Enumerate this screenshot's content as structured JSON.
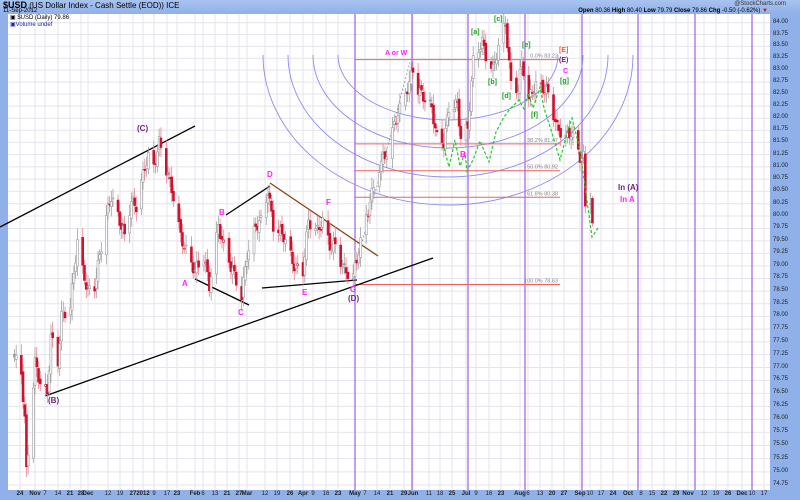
{
  "header": {
    "symbol": "$USD",
    "name": "(US Dollar Index - Cash Settle (EOD)) ICE",
    "date": "11-Sep-2012",
    "brand": "@StockCharts.com",
    "open_label": "Open",
    "open": "80.36",
    "high_label": "High",
    "high": "80.40",
    "low_label": "Low",
    "low": "79.79",
    "close_label": "Close",
    "close": "79.86",
    "chg_label": "Chg",
    "chg": "-0.50 (-0.62%)",
    "chg_icon": "triangle-down-icon"
  },
  "legend": {
    "line1": "$USD (Daily) 79.86",
    "line2": "Volume undef"
  },
  "colors": {
    "up": "#9a9a9a",
    "down": "#d0102c",
    "fib": "#f06060",
    "cycle": "#a060e0",
    "arc": "#8c8cf0",
    "projection": "#22cc22",
    "grid": "#e4e4ee",
    "frame": "#8fb0e8"
  },
  "chart_data": {
    "type": "candlestick",
    "title": "$USD (US Dollar Index - Cash Settle (EOD)) ICE",
    "y_scale": "log",
    "ylim": [
      74.6,
      84.2
    ],
    "grid": true,
    "last_bar": {
      "date": "2012-09-11",
      "open": 80.36,
      "high": 80.4,
      "low": 79.79,
      "close": 79.86
    },
    "approx_closes": [
      [
        "2011-10-20",
        77.2
      ],
      [
        "2011-10-24",
        76.9
      ],
      [
        "2011-10-26",
        76.0
      ],
      [
        "2011-10-27",
        75.0
      ],
      [
        "2011-10-28",
        75.4
      ],
      [
        "2011-11-01",
        77.1
      ],
      [
        "2011-11-04",
        76.7
      ],
      [
        "2011-11-08",
        76.5
      ],
      [
        "2011-11-10",
        77.6
      ],
      [
        "2011-11-14",
        77.1
      ],
      [
        "2011-11-16",
        78.0
      ],
      [
        "2011-11-21",
        78.2
      ],
      [
        "2011-11-25",
        79.5
      ],
      [
        "2011-11-28",
        78.9
      ],
      [
        "2011-12-01",
        78.5
      ],
      [
        "2011-12-05",
        78.6
      ],
      [
        "2011-12-08",
        79.2
      ],
      [
        "2011-12-12",
        80.0
      ],
      [
        "2011-12-15",
        80.4
      ],
      [
        "2011-12-19",
        80.0
      ],
      [
        "2011-12-23",
        79.6
      ],
      [
        "2011-12-27",
        80.3
      ],
      [
        "2011-12-30",
        80.2
      ],
      [
        "2012-01-04",
        81.0
      ],
      [
        "2012-01-06",
        81.2
      ],
      [
        "2012-01-09",
        81.0
      ],
      [
        "2012-01-12",
        81.5
      ],
      [
        "2012-01-13",
        81.4
      ],
      [
        "2012-01-17",
        80.8
      ],
      [
        "2012-01-20",
        80.4
      ],
      [
        "2012-01-24",
        79.6
      ],
      [
        "2012-01-27",
        79.3
      ],
      [
        "2012-02-01",
        78.9
      ],
      [
        "2012-02-06",
        79.2
      ],
      [
        "2012-02-09",
        78.6
      ],
      [
        "2012-02-14",
        79.8
      ],
      [
        "2012-02-17",
        79.4
      ],
      [
        "2012-02-22",
        78.9
      ],
      [
        "2012-02-27",
        78.4
      ],
      [
        "2012-03-01",
        79.2
      ],
      [
        "2012-03-06",
        79.8
      ],
      [
        "2012-03-09",
        79.9
      ],
      [
        "2012-03-13",
        80.5
      ],
      [
        "2012-03-16",
        79.8
      ],
      [
        "2012-03-22",
        79.6
      ],
      [
        "2012-03-28",
        79.0
      ],
      [
        "2012-04-02",
        78.9
      ],
      [
        "2012-04-05",
        79.9
      ],
      [
        "2012-04-10",
        79.7
      ],
      [
        "2012-04-13",
        79.9
      ],
      [
        "2012-04-17",
        79.4
      ],
      [
        "2012-04-20",
        79.4
      ],
      [
        "2012-04-25",
        78.9
      ],
      [
        "2012-04-30",
        78.8
      ],
      [
        "2012-05-03",
        79.3
      ],
      [
        "2012-05-09",
        80.3
      ],
      [
        "2012-05-14",
        81.0
      ],
      [
        "2012-05-18",
        81.3
      ],
      [
        "2012-05-23",
        82.0
      ],
      [
        "2012-05-28",
        82.5
      ],
      [
        "2012-06-01",
        83.0
      ],
      [
        "2012-06-04",
        82.6
      ],
      [
        "2012-06-08",
        82.4
      ],
      [
        "2012-06-12",
        82.2
      ],
      [
        "2012-06-15",
        81.6
      ],
      [
        "2012-06-19",
        81.5
      ],
      [
        "2012-06-22",
        82.2
      ],
      [
        "2012-06-27",
        82.3
      ],
      [
        "2012-06-29",
        81.6
      ],
      [
        "2012-07-03",
        81.8
      ],
      [
        "2012-07-06",
        83.2
      ],
      [
        "2012-07-11",
        83.6
      ],
      [
        "2012-07-13",
        83.3
      ],
      [
        "2012-07-17",
        83.0
      ],
      [
        "2012-07-20",
        83.5
      ],
      [
        "2012-07-24",
        84.0
      ],
      [
        "2012-07-27",
        82.7
      ],
      [
        "2012-07-31",
        82.6
      ],
      [
        "2012-08-02",
        83.2
      ],
      [
        "2012-08-06",
        82.4
      ],
      [
        "2012-08-10",
        82.7
      ],
      [
        "2012-08-15",
        82.6
      ],
      [
        "2012-08-17",
        82.5
      ],
      [
        "2012-08-22",
        81.8
      ],
      [
        "2012-08-27",
        81.6
      ],
      [
        "2012-08-30",
        81.7
      ],
      [
        "2012-09-04",
        81.2
      ],
      [
        "2012-09-06",
        81.2
      ],
      [
        "2012-09-07",
        80.2
      ],
      [
        "2012-09-10",
        80.36
      ]
    ],
    "fib_levels": [
      {
        "label": "0.0% 83.22",
        "value": 83.22
      },
      {
        "label": "38.2% 81.47",
        "value": 81.47
      },
      {
        "label": "50.0% 80.92",
        "value": 80.92
      },
      {
        "label": "61.8% 80.38",
        "value": 80.38
      },
      {
        "label": "100.0% 78.63",
        "value": 78.63
      }
    ],
    "y_ticks": [
      "84.00",
      "83.75",
      "83.50",
      "83.25",
      "83.00",
      "82.75",
      "82.50",
      "82.25",
      "82.00",
      "81.75",
      "81.50",
      "81.25",
      "81.00",
      "80.75",
      "80.50",
      "80.25",
      "80.00",
      "79.75",
      "79.50",
      "79.25",
      "79.00",
      "78.75",
      "78.50",
      "78.25",
      "78.00",
      "77.75",
      "77.50",
      "77.25",
      "77.00",
      "76.75",
      "76.50",
      "76.25",
      "76.00",
      "75.75",
      "75.50",
      "75.25",
      "75.00",
      "74.75"
    ],
    "x_ticks": [
      "24",
      "Nov",
      "7",
      "14",
      "21",
      "28",
      "Dec",
      "12",
      "19",
      "27",
      "2012",
      "9",
      "17",
      "23",
      "Feb",
      "6",
      "13",
      "21",
      "27",
      "Mar",
      "12",
      "19",
      "26",
      "Apr",
      "9",
      "16",
      "23",
      "May",
      "7",
      "14",
      "21",
      "29",
      "Jun",
      "11",
      "18",
      "25",
      "Jul",
      "9",
      "16",
      "23",
      "Aug",
      "6",
      "13",
      "20",
      "27",
      "Sep",
      "10",
      "17",
      "24",
      "Oct",
      "8",
      "15",
      "22",
      "29",
      "Nov",
      "12",
      "19",
      "26",
      "Dec",
      "10",
      "17"
    ],
    "annotations": {
      "C_paren": "(C)",
      "B_paren": "(B)",
      "A": "A",
      "B": "B",
      "C": "C",
      "D": "D",
      "E": "E",
      "F": "F",
      "G": "G",
      "D_paren": "(D)",
      "A_or_W": "A or W",
      "B2": "B",
      "a": "[a]",
      "b": "[b]",
      "c": "[c]",
      "d": "[d]",
      "e": "[e]",
      "f": "[f]",
      "g": "[g]",
      "E_bracket": "[E]",
      "E_paren": "(E)",
      "C2": "C",
      "in_A_paren": "In (A)",
      "in_A": "In A"
    }
  }
}
